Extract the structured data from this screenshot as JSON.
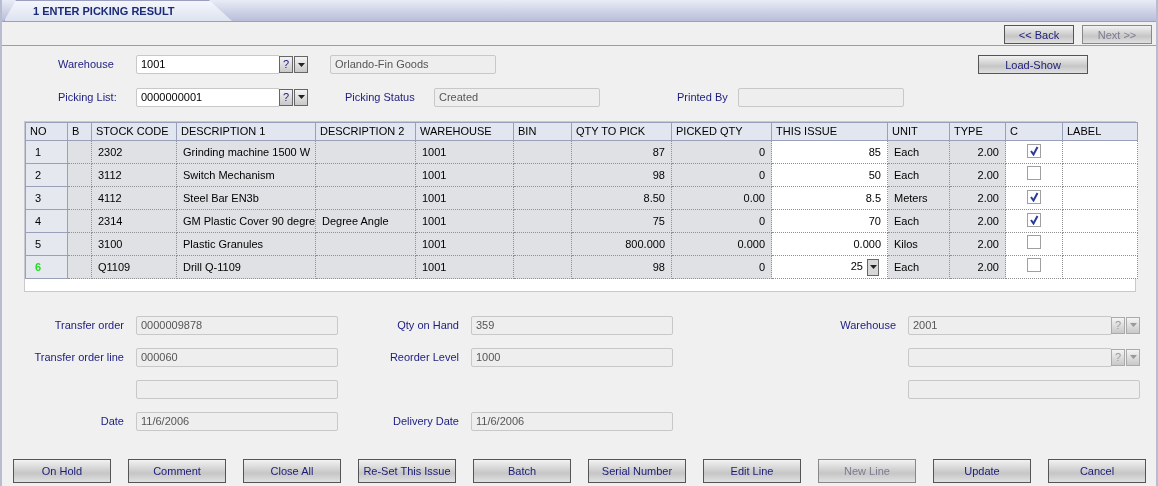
{
  "tab": {
    "label": "1 ENTER PICKING RESULT",
    "selected": true
  },
  "nav_buttons": [
    {
      "label": "<< Back",
      "disabled": false
    },
    {
      "label": "Next >>",
      "disabled": true
    }
  ],
  "header": {
    "warehouse": {
      "label": "Warehouse",
      "value": "1001",
      "help_symbol": "?",
      "description": "Orlando-Fin Goods"
    },
    "load_show": {
      "label": "Load-Show"
    },
    "picking_list": {
      "label": "Picking List:",
      "value": "0000000001",
      "help_symbol": "?"
    },
    "picking_status": {
      "label": "Picking Status",
      "value": "Created"
    },
    "printed_by": {
      "label": "Printed By"
    }
  },
  "table": {
    "columns": [
      "NO",
      "B",
      "STOCK CODE",
      "DESCRIPTION 1",
      "DESCRIPTION 2",
      "WAREHOUSE",
      "BIN",
      "QTY TO PICK",
      "PICKED QTY",
      "THIS ISSUE",
      "UNIT",
      "TYPE",
      "C",
      "LABEL"
    ],
    "rows": [
      {
        "no": "1",
        "current": false,
        "stock_code": "2302",
        "description_1": "Grinding machine 1500 W",
        "warehouse": "1001",
        "qty_to_pick": "87",
        "picked_qty": "0",
        "this_issue": "85",
        "unit": "Each",
        "type": "2.00",
        "checked": true
      },
      {
        "no": "2",
        "current": false,
        "stock_code": "3112",
        "description_1": "Switch Mechanism",
        "warehouse": "1001",
        "qty_to_pick": "98",
        "picked_qty": "0",
        "this_issue": "50",
        "unit": "Each",
        "type": "2.00",
        "checked": false
      },
      {
        "no": "3",
        "current": false,
        "stock_code": "4112",
        "description_1": "Steel Bar EN3b",
        "warehouse": "1001",
        "qty_to_pick": "8.50",
        "picked_qty": "0.00",
        "this_issue": "8.5",
        "unit": "Meters",
        "type": "2.00",
        "checked": true
      },
      {
        "no": "4",
        "current": false,
        "stock_code": "2314",
        "description_1": "GM Plastic Cover 90 degre",
        "description_2": "Degree Angle",
        "warehouse": "1001",
        "qty_to_pick": "75",
        "picked_qty": "0",
        "this_issue": "70",
        "unit": "Each",
        "type": "2.00",
        "checked": true
      },
      {
        "no": "5",
        "current": false,
        "stock_code": "3100",
        "description_1": "Plastic Granules",
        "warehouse": "1001",
        "qty_to_pick": "800.000",
        "picked_qty": "0.000",
        "this_issue": "0.000",
        "unit": "Kilos",
        "type": "2.00",
        "checked": false
      },
      {
        "no": "6",
        "current": true,
        "stock_code": "Q1109",
        "description_1": "Drill Q-1109",
        "warehouse": "1001",
        "qty_to_pick": "98",
        "picked_qty": "0",
        "this_issue": "25",
        "unit": "Each",
        "type": "2.00",
        "checked": false
      }
    ]
  },
  "details": {
    "left": [
      {
        "kind": "text",
        "label": "Transfer order",
        "value": "0000009878"
      },
      {
        "kind": "text",
        "label": "Transfer order line",
        "value": "000060"
      },
      {
        "kind": "text"
      },
      {
        "kind": "text",
        "label": "Date",
        "value": "11/6/2006"
      }
    ],
    "middle": [
      {
        "kind": "text",
        "label": "Qty on Hand",
        "value": "359"
      },
      {
        "kind": "text",
        "label": "Reorder Level",
        "value": "1000"
      },
      {
        "kind": "text",
        "label": "Delivery Date",
        "value": "11/6/2006"
      }
    ],
    "right": [
      {
        "kind": "lookup",
        "label": "Warehouse",
        "value": "2001",
        "help_symbol": "?"
      },
      {
        "kind": "lookup",
        "help_symbol": "?"
      },
      {
        "kind": "text"
      }
    ]
  },
  "buttons": [
    {
      "label": "On Hold",
      "disabled": false
    },
    {
      "label": "Comment",
      "disabled": false
    },
    {
      "label": "Close All",
      "disabled": false
    },
    {
      "label": "Re-Set This Issue",
      "disabled": false
    },
    {
      "label": "Batch",
      "disabled": false
    },
    {
      "label": "Serial Number",
      "disabled": false
    },
    {
      "label": "Edit Line",
      "disabled": false
    },
    {
      "label": "New Line",
      "disabled": true
    },
    {
      "label": "Update",
      "disabled": false
    },
    {
      "label": "Cancel",
      "disabled": false
    }
  ]
}
